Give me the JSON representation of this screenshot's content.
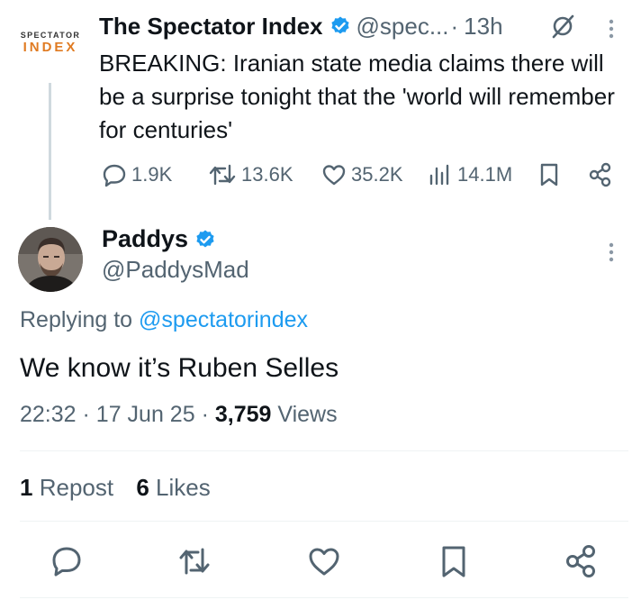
{
  "colors": {
    "accent": "#1d9bf0",
    "text": "#0f1419",
    "muted": "#536471",
    "divider": "#eff3f4",
    "logo_orange": "#e07b22"
  },
  "parent": {
    "logo": {
      "top": "SPECTATOR",
      "bottom": "INDEX"
    },
    "name": "The Spectator Index",
    "handle": "@spec...",
    "separator": "·",
    "time": "13h",
    "text": "BREAKING: Iranian state media claims there will be a surprise tonight that the 'world will remember for centuries'",
    "actions": {
      "replies": "1.9K",
      "reposts": "13.6K",
      "likes": "35.2K",
      "views": "14.1M"
    },
    "icons": [
      "reply-icon",
      "repost-icon",
      "like-icon",
      "views-icon",
      "bookmark-icon",
      "share-icon",
      "grok-icon",
      "more-icon",
      "verified-badge-icon"
    ]
  },
  "reply": {
    "name": "Paddys",
    "handle": "@PaddysMad",
    "replying_prefix": "Replying to",
    "replying_to": "@spectatorindex",
    "text": "We know it’s Ruben Selles",
    "time": "22:32",
    "date": "17 Jun 25",
    "meta_sep": "·",
    "views_count": "3,759",
    "views_label": "Views",
    "repost_count": "1",
    "repost_label": "Repost",
    "likes_count": "6",
    "likes_label": "Likes"
  }
}
